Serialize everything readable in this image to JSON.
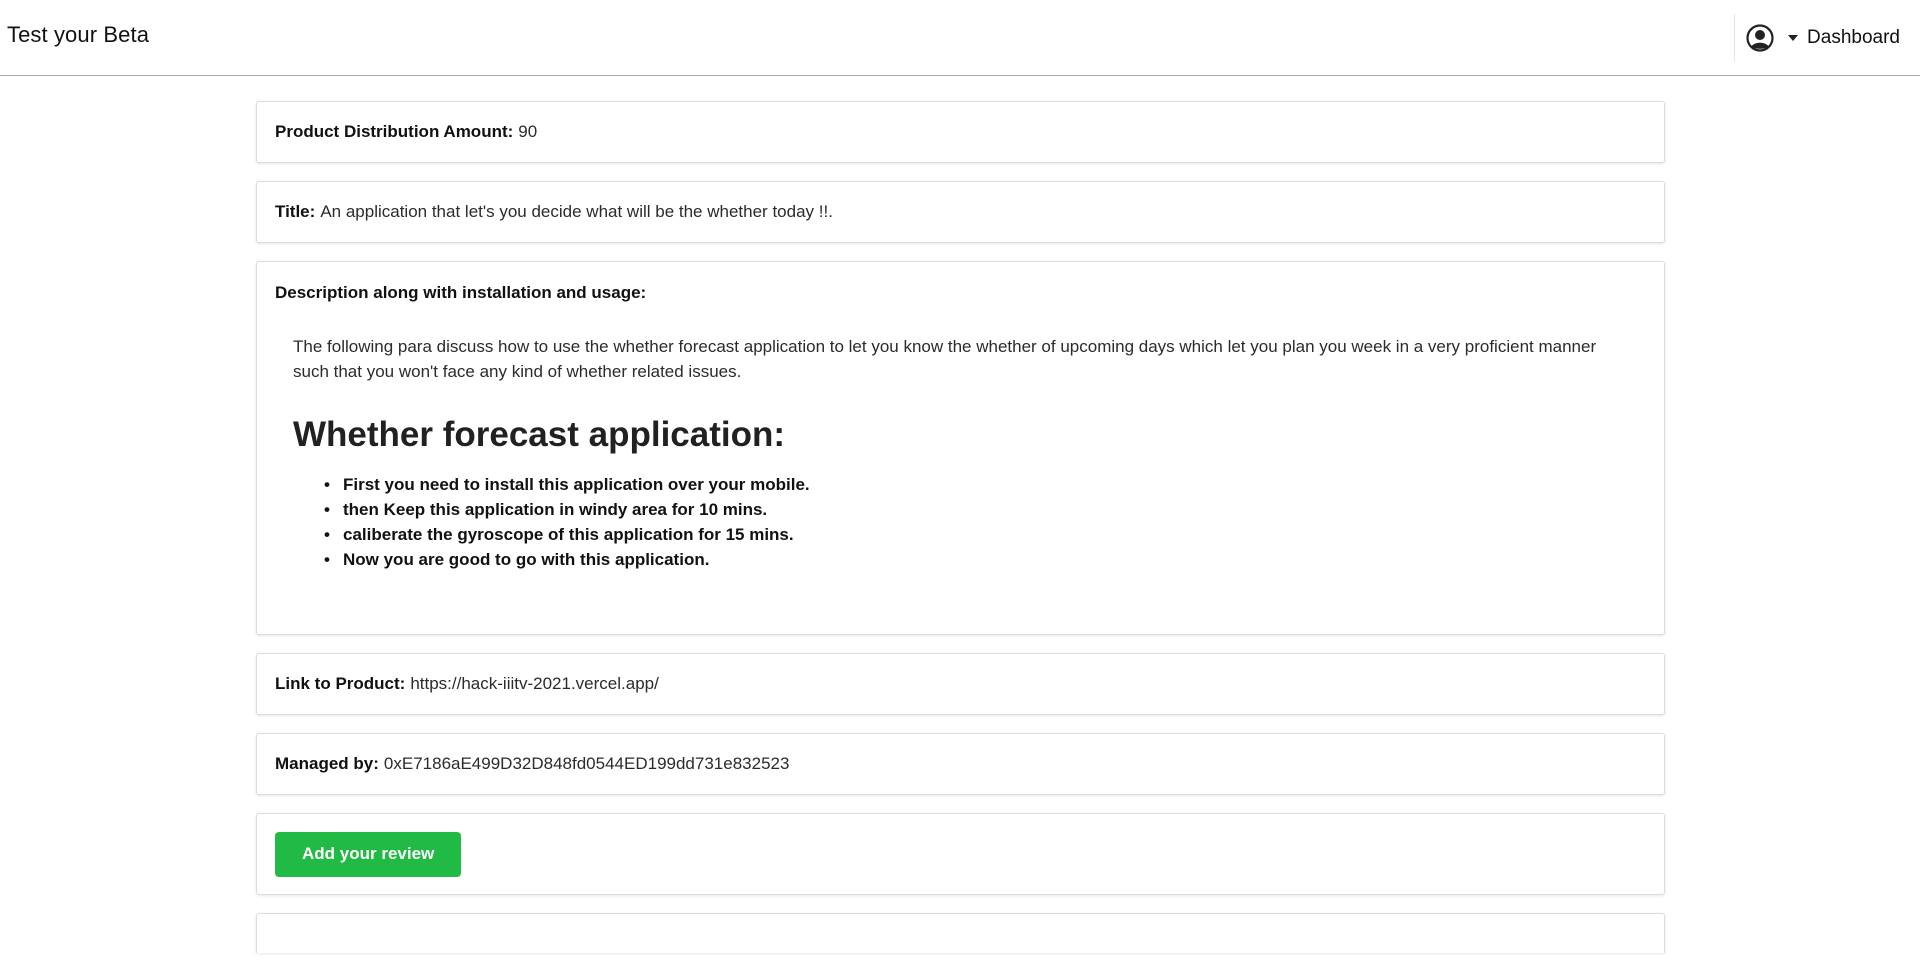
{
  "navbar": {
    "brand": "Test your Beta",
    "avatar_icon": "user-circle-icon",
    "dropdown_icon": "caret-down-icon",
    "dashboard_label": "Dashboard"
  },
  "fields": {
    "distribution": {
      "label": "Product Distribution Amount:",
      "value": "90"
    },
    "title": {
      "label": "Title:",
      "value": "An application that let's you decide what will be the whether today !!."
    },
    "description": {
      "label": "Description along with installation and usage:",
      "para": "The following para discuss how to use the whether forecast application to let you know the whether of upcoming days which let you plan you week in a very proficient manner such that you won't face any kind of whether related issues.",
      "heading": "Whether forecast application:",
      "steps": [
        "First you need to install this application over your mobile.",
        "then Keep this application in windy area for 10 mins.",
        "caliberate the gyroscope of this application for 15 mins.",
        "Now you are good to go with this application."
      ]
    },
    "link": {
      "label": "Link to Product:",
      "value": "https://hack-iiitv-2021.vercel.app/"
    },
    "manager": {
      "label": "Managed by:",
      "value": "0xE7186aE499D32D848fd0544ED199dd731e832523"
    }
  },
  "actions": {
    "review_button": "Add your review"
  },
  "colors": {
    "primary_green": "#21ba45",
    "divider": "#a8a8a8"
  }
}
